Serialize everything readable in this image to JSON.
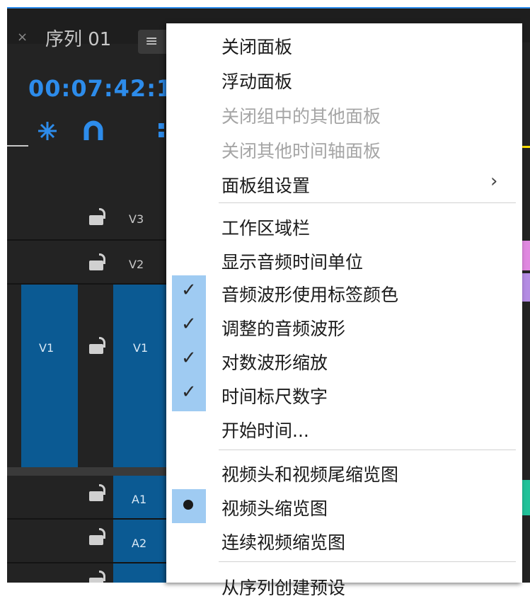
{
  "tab": {
    "close_glyph": "×",
    "title": "序列 01",
    "menu_glyph": "≡"
  },
  "timecode": "00:07:42:1",
  "tracks": [
    {
      "name": "V3"
    },
    {
      "name": "V2"
    },
    {
      "name": "V1",
      "source_label": "V1"
    },
    {
      "name": "A1"
    },
    {
      "name": "A2"
    }
  ],
  "menu": {
    "items": [
      {
        "label": "关闭面板",
        "disabled": false
      },
      {
        "label": "浮动面板",
        "disabled": false
      },
      {
        "label": "关闭组中的其他面板",
        "disabled": true
      },
      {
        "label": "关闭其他时间轴面板",
        "disabled": true
      },
      {
        "label": "面板组设置",
        "disabled": false,
        "submenu_arrow": "›"
      },
      {
        "label": "工作区域栏",
        "disabled": false
      },
      {
        "label": "显示音频时间单位",
        "disabled": false
      },
      {
        "label": "音频波形使用标签颜色",
        "disabled": false,
        "checked": true
      },
      {
        "label": "调整的音频波形",
        "disabled": false,
        "checked": true
      },
      {
        "label": "对数波形缩放",
        "disabled": false,
        "checked": true
      },
      {
        "label": "时间标尺数字",
        "disabled": false,
        "checked": true
      },
      {
        "label": "开始时间...",
        "disabled": false
      },
      {
        "label": "视频头和视频尾缩览图",
        "disabled": false
      },
      {
        "label": "视频头缩览图",
        "disabled": false,
        "selected": true
      },
      {
        "label": "连续视频缩览图",
        "disabled": false
      },
      {
        "label": "从序列创建预设",
        "disabled": false
      }
    ],
    "check_glyph": "✓"
  },
  "colors": {
    "accent": "#2d8ceb",
    "track_blue": "#0b5a93",
    "check_highlight": "#9fcbf2",
    "clip_pink": "#e089e0",
    "clip_purple": "#b48ce3",
    "clip_teal": "#22c29a"
  }
}
